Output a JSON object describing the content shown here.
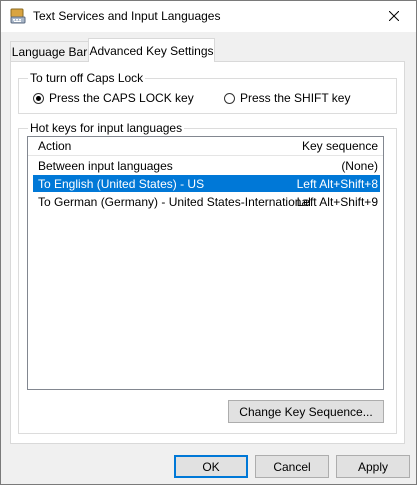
{
  "window": {
    "title": "Text Services and Input Languages"
  },
  "tabs": [
    {
      "label": "Language Bar"
    },
    {
      "label": "Advanced Key Settings"
    }
  ],
  "caps_lock": {
    "group_label": "To turn off Caps Lock",
    "options": [
      {
        "label": "Press the CAPS LOCK key",
        "selected": true
      },
      {
        "label": "Press the SHIFT key",
        "selected": false
      }
    ]
  },
  "hotkeys": {
    "group_label": "Hot keys for input languages",
    "columns": {
      "action": "Action",
      "key_sequence": "Key sequence"
    },
    "rows": [
      {
        "action": "Between input languages",
        "key": "(None)"
      },
      {
        "action": "To English (United States) - US",
        "key": "Left Alt+Shift+8"
      },
      {
        "action": "To German (Germany) - United States-International",
        "key": "Left Alt+Shift+9"
      }
    ],
    "change_button": "Change Key Sequence..."
  },
  "buttons": {
    "ok": "OK",
    "cancel": "Cancel",
    "apply": "Apply"
  },
  "colors": {
    "selection": "#0078d7",
    "close_hover": "#e81123"
  }
}
